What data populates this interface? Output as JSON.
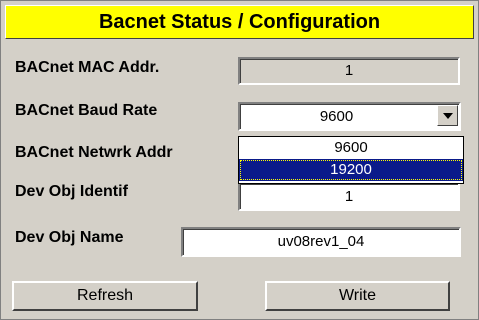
{
  "title": "Bacnet Status / Configuration",
  "fields": {
    "mac_addr": {
      "label": "BACnet MAC Addr.",
      "value": "1"
    },
    "baud_rate": {
      "label": "BACnet Baud Rate",
      "value": "9600"
    },
    "network_addr": {
      "label": "BACnet Netwrk Addr"
    },
    "dev_obj_identif": {
      "label": "Dev Obj Identif",
      "value": "1"
    },
    "dev_obj_name": {
      "label": "Dev Obj Name",
      "value": "uv08rev1_04"
    }
  },
  "baud_options": [
    {
      "label": "9600"
    },
    {
      "label": "19200"
    }
  ],
  "buttons": {
    "refresh": "Refresh",
    "write": "Write"
  },
  "icons": {
    "dropdown_arrow": "chevron-down-icon"
  },
  "colors": {
    "title_bg": "#ffff00",
    "panel_bg": "#d4d0c8",
    "selection_bg": "#0a1a8a"
  }
}
